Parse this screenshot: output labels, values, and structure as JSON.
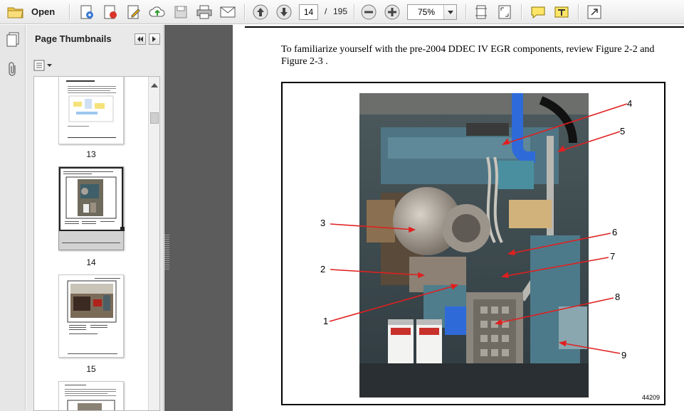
{
  "toolbar": {
    "open_label": "Open",
    "current_page": "14",
    "page_separator": "/",
    "total_pages": "195",
    "zoom": "75%"
  },
  "thumbnails": {
    "title": "Page Thumbnails",
    "pages": [
      {
        "label": "13"
      },
      {
        "label": "14"
      },
      {
        "label": "15"
      }
    ]
  },
  "document": {
    "intro_text": "To familiarize yourself with the pre-2004 DDEC IV EGR components, review Figure 2-2 and Figure 2-3 .",
    "figure_number": "44209",
    "callouts": [
      "1",
      "2",
      "3",
      "4",
      "5",
      "6",
      "7",
      "8",
      "9"
    ]
  }
}
